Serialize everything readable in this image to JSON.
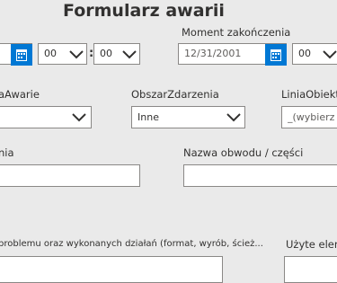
{
  "title": "Formularz awarii",
  "moment_zakonczenia": {
    "label": "Moment zakończenia",
    "date_placeholder": "12/31/2001"
  },
  "start_time": {
    "hour": "00",
    "minute": "00"
  },
  "end_time": {
    "hour": "00"
  },
  "fields": {
    "przyczyna_label": "aAwarie",
    "obszar_label": "ObszarZdarzenia",
    "obszar_value": "Inne",
    "linia_label": "LiniaObiektZ",
    "linia_placeholder": "_(wybierz ob",
    "left_label2": "nia",
    "nazwa_obwodu_label": "Nazwa obwodu / części",
    "opis_label": "problemu oraz wykonanych działań (format, wyrób, ścież...",
    "uzyte_label": "Użyte eleme"
  },
  "colors": {
    "accent": "#0078d4",
    "background": "#eaeaea"
  },
  "icons": {
    "calendar": "calendar-icon",
    "dropdown": "chevron-down-icon"
  }
}
